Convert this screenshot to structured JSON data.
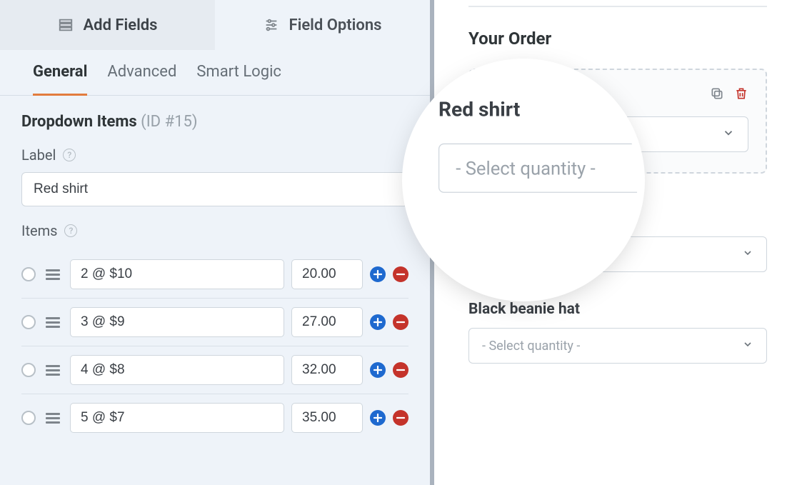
{
  "toptabs": {
    "add": "Add Fields",
    "options": "Field Options"
  },
  "subtabs": {
    "general": "General",
    "advanced": "Advanced",
    "smart": "Smart Logic"
  },
  "section": {
    "title": "Dropdown Items",
    "id_label": "(ID #15)"
  },
  "labels": {
    "label": "Label",
    "items": "Items"
  },
  "label_value": "Red shirt",
  "items": [
    {
      "label": "2 @ $10",
      "price": "20.00"
    },
    {
      "label": "3 @ $9",
      "price": "27.00"
    },
    {
      "label": "4 @ $8",
      "price": "32.00"
    },
    {
      "label": "5 @ $7",
      "price": "35.00"
    }
  ],
  "preview": {
    "order_title": "Your Order",
    "select_ph": "- Select quantity -",
    "fields": [
      {
        "name": "Red shirt"
      },
      {
        "name": "Black beanie hat"
      }
    ]
  },
  "magnifier": {
    "name": "Red shirt",
    "select_ph": "- Select quantity -"
  }
}
